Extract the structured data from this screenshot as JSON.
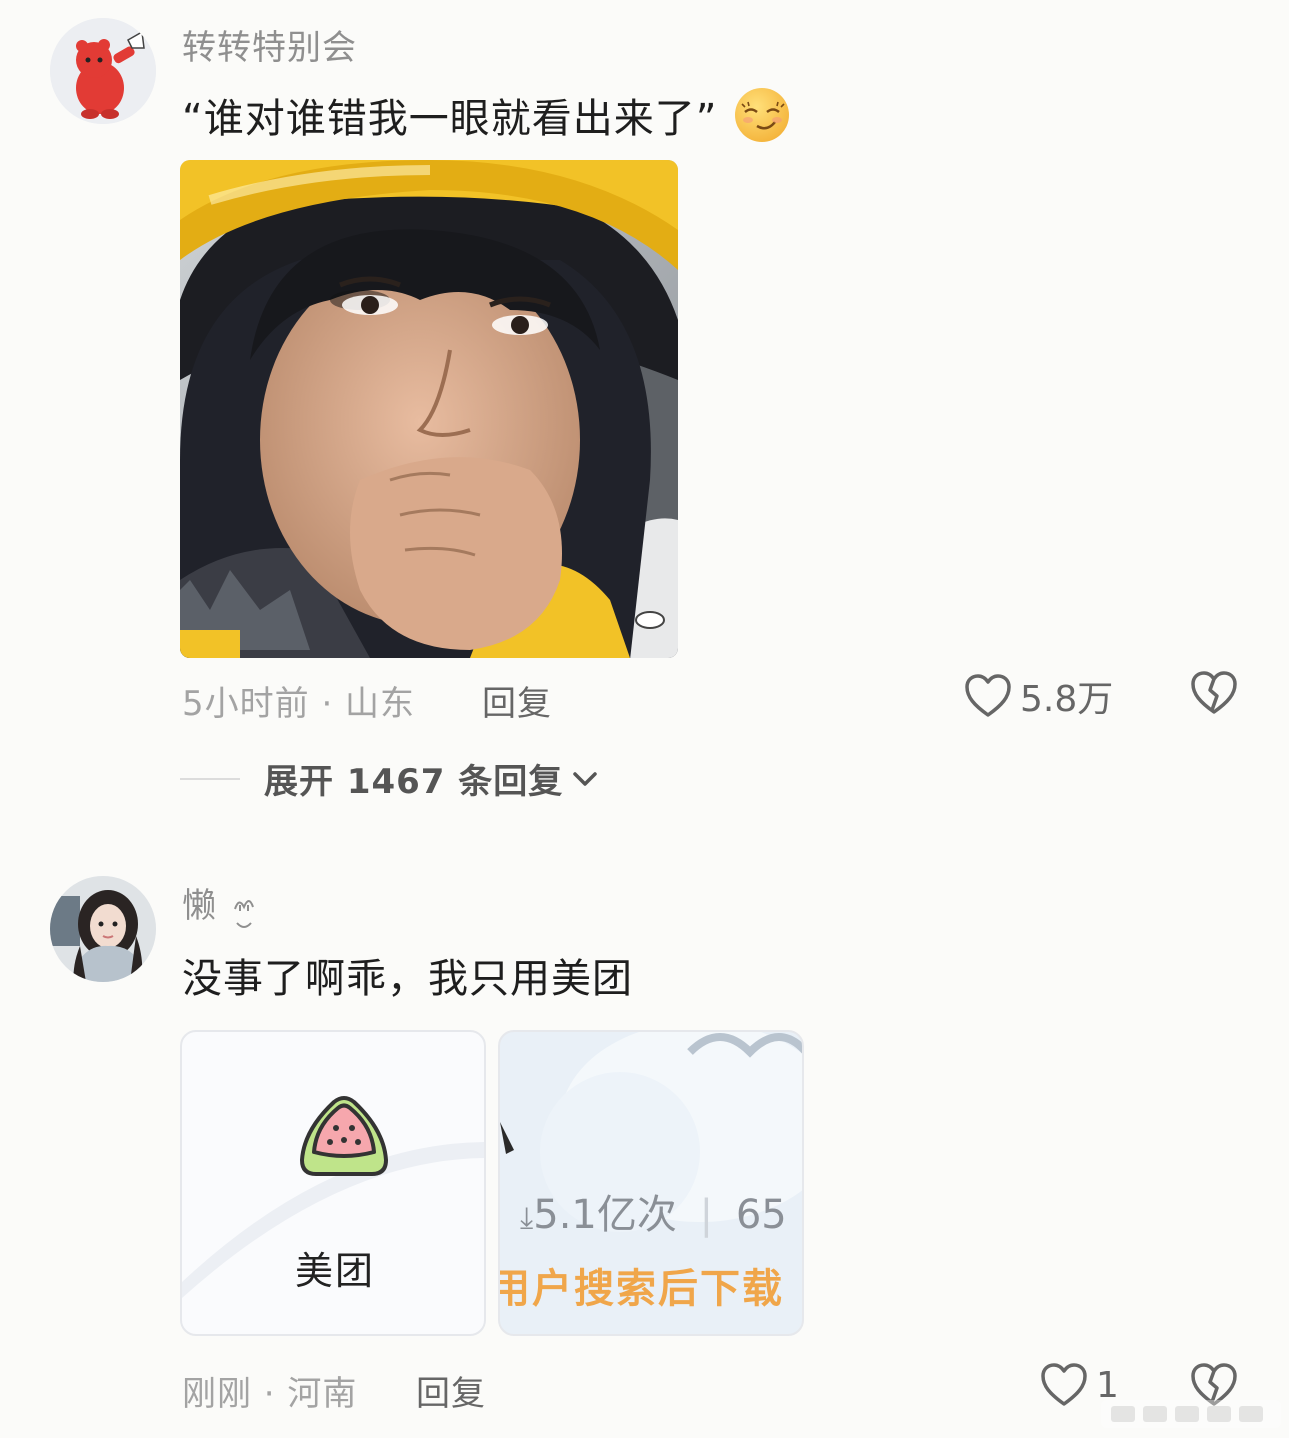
{
  "comments": [
    {
      "username": "转转特别会",
      "text": "“谁对谁错我一眼就看出来了”",
      "emoji": "smirk-face-emoji",
      "time_location": "5小时前 · 山东",
      "reply_label": "回复",
      "likes": "5.8万",
      "expand_label": "展开 1467 条回复"
    },
    {
      "username": "懒",
      "text": "没事了啊乖，我只用美团",
      "time_location": "刚刚 · 河南",
      "reply_label": "回复",
      "likes": "1",
      "cards": [
        {
          "app_name": "美团"
        },
        {
          "downloads": "5.1亿次",
          "rating_partial": "65",
          "banner": "用户搜索后下载"
        }
      ]
    }
  ],
  "colors": {
    "accent_yellow": "#f2c227",
    "text_primary": "#1e1e1e",
    "text_muted": "#a3a3a3",
    "orange_banner": "#f0a64a"
  }
}
